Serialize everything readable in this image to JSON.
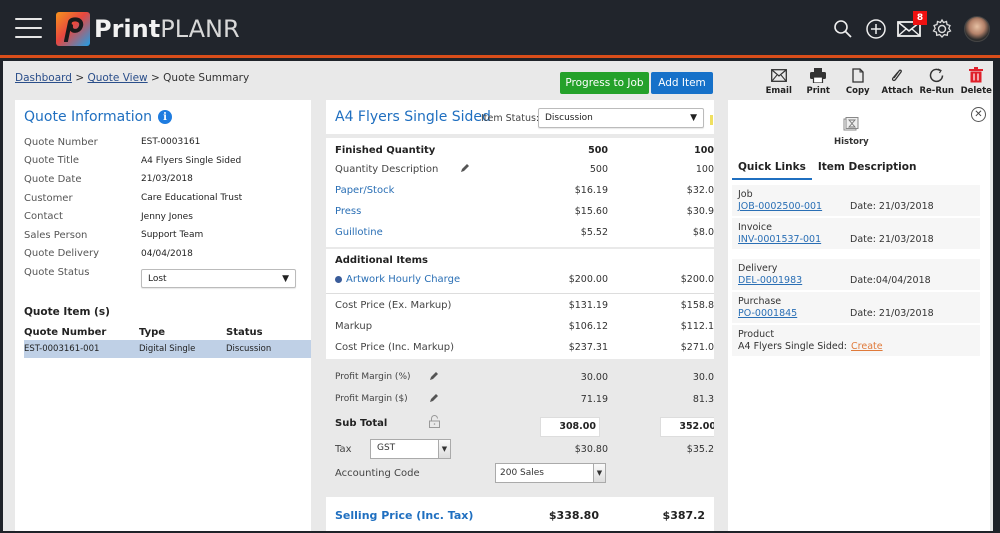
{
  "app": {
    "logo_bold": "Print",
    "logo_light": "PLANR",
    "mail_badge": "8"
  },
  "breadcrumb": {
    "items": [
      "Dashboard",
      "Quote View",
      "Quote Summary"
    ],
    "separator": ">"
  },
  "actions": {
    "progress_to_job": "Progress to Job",
    "add_item": "Add Item"
  },
  "toolbar": [
    {
      "label": "Email",
      "icon": "envelope-icon"
    },
    {
      "label": "Print",
      "icon": "printer-icon"
    },
    {
      "label": "Copy",
      "icon": "copy-icon"
    },
    {
      "label": "Attach",
      "icon": "paperclip-icon"
    },
    {
      "label": "Re-Run",
      "icon": "refresh-icon"
    },
    {
      "label": "Delete",
      "icon": "trash-icon"
    }
  ],
  "quote_info": {
    "title": "Quote Information",
    "fields": [
      {
        "label": "Quote Number",
        "value": "EST-0003161"
      },
      {
        "label": "Quote Title",
        "value": "A4 Flyers Single Sided"
      },
      {
        "label": "Quote Date",
        "value": "21/03/2018"
      },
      {
        "label": "Customer",
        "value": "Care Educational Trust"
      },
      {
        "label": "Contact",
        "value": "Jenny Jones"
      },
      {
        "label": "Sales Person",
        "value": "Support Team"
      },
      {
        "label": "Quote Delivery",
        "value": "04/04/2018"
      }
    ],
    "status_label": "Quote Status",
    "status_value": "Lost"
  },
  "quote_items": {
    "title": "Quote Item (s)",
    "columns": [
      "Quote Number",
      "Type",
      "Status"
    ],
    "rows": [
      {
        "number": "EST-0003161-001",
        "type": "Digital Single",
        "status": "Discussion"
      }
    ]
  },
  "item": {
    "title": "A4 Flyers Single Sided",
    "status_label": "Item Status:",
    "status_value": "Discussion",
    "finished_quantity": {
      "label": "Finished Quantity",
      "v1": "500",
      "v2": "100"
    },
    "quantity_description": {
      "label": "Quantity Description",
      "v1": "500",
      "v2": "100"
    },
    "costs": [
      {
        "label": "Paper/Stock",
        "v1": "$16.19",
        "v2": "$32.0"
      },
      {
        "label": "Press",
        "v1": "$15.60",
        "v2": "$30.9"
      },
      {
        "label": "Guillotine",
        "v1": "$5.52",
        "v2": "$8.0"
      }
    ],
    "additional_title": "Additional Items",
    "additional": [
      {
        "label": "Artwork Hourly Charge",
        "v1": "$200.00",
        "v2": "$200.0"
      }
    ],
    "summary": [
      {
        "label": "Cost Price (Ex. Markup)",
        "v1": "$131.19",
        "v2": "$158.8"
      },
      {
        "label": "Markup",
        "v1": "$106.12",
        "v2": "$112.1"
      },
      {
        "label": "Cost Price (Inc. Markup)",
        "v1": "$237.31",
        "v2": "$271.0"
      }
    ],
    "profit_pct": {
      "label": "Profit Margin (%)",
      "v1": "30.00",
      "v2": "30.0"
    },
    "profit_amt": {
      "label": "Profit Margin ($)",
      "v1": "71.19",
      "v2": "81.3"
    },
    "sub_total": {
      "label": "Sub Total",
      "v1": "308.00",
      "v2": "352.00"
    },
    "tax": {
      "label": "Tax",
      "select": "GST",
      "v1": "$30.80",
      "v2": "$35.2"
    },
    "accounting": {
      "label": "Accounting Code",
      "select": "200 Sales"
    },
    "selling": {
      "label": "Selling Price (Inc. Tax)",
      "v1": "$338.80",
      "v2": "$387.2"
    }
  },
  "side": {
    "history_label": "History",
    "tabs": [
      "Quick Links",
      "Item Description"
    ],
    "links": [
      {
        "type": "Job",
        "ref": "JOB-0002500-001",
        "date": "Date: 21/03/2018"
      },
      {
        "type": "Invoice",
        "ref": "INV-0001537-001",
        "date": "Date: 21/03/2018"
      },
      {
        "type": "Delivery",
        "ref": "DEL-0001983",
        "date": "Date:04/04/2018"
      },
      {
        "type": "Purchase",
        "ref": "PO-0001845",
        "date": "Date: 21/03/2018"
      }
    ],
    "product": {
      "type": "Product",
      "text": "A4 Flyers Single Sided:",
      "action": "Create"
    }
  },
  "colors": {
    "accent_blue": "#1f6fc0",
    "green_button": "#24a12a",
    "blue_button": "#1671c9",
    "topbar": "#21252c",
    "topbar_border": "#d94d1a",
    "delete_red": "#e0202a",
    "create_orange": "#e07a3a"
  }
}
